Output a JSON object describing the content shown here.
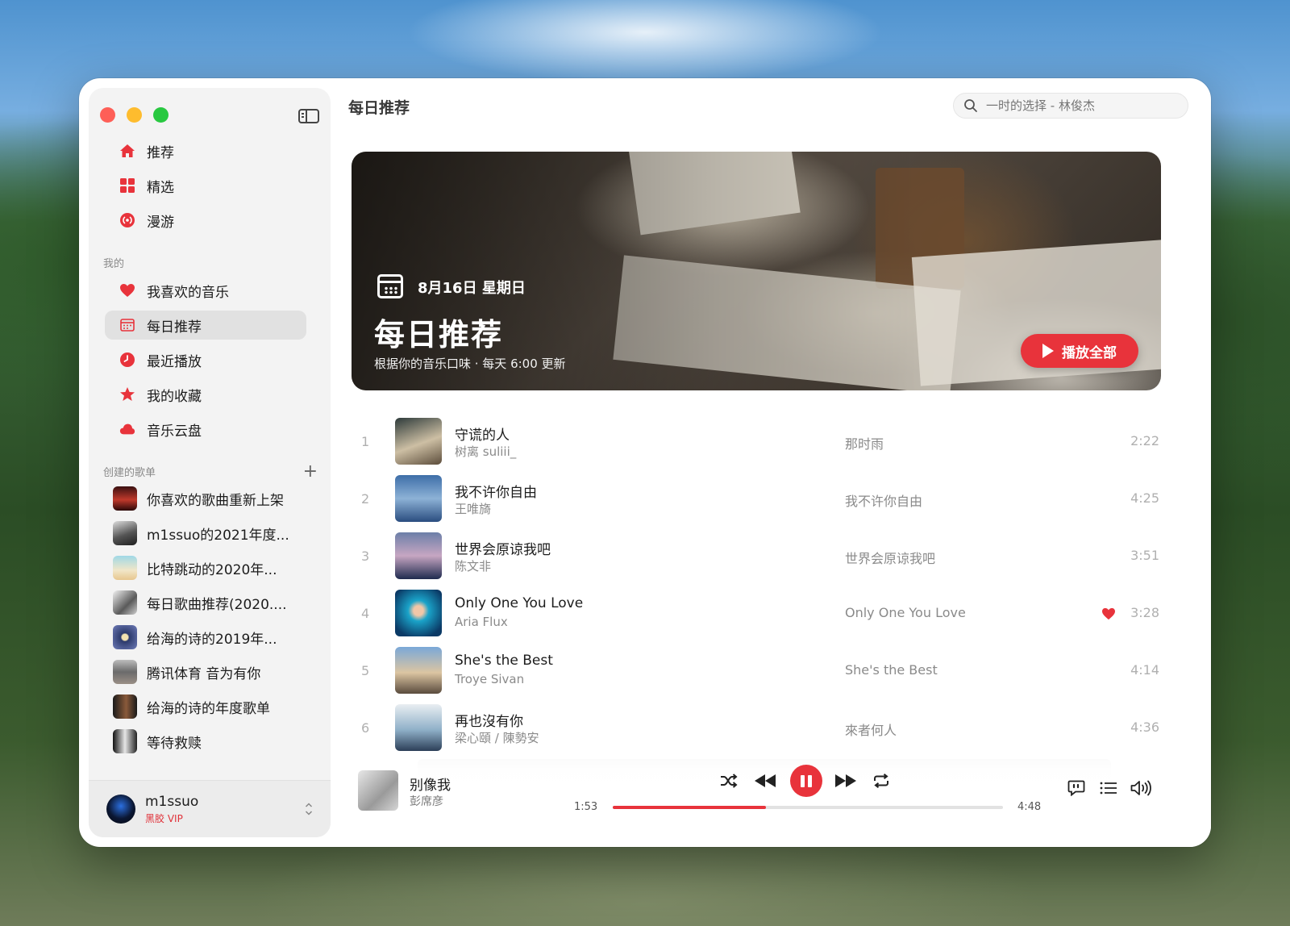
{
  "window": {
    "page_title": "每日推荐"
  },
  "search": {
    "placeholder": "一时的选择 - 林俊杰"
  },
  "sidebar": {
    "nav": [
      {
        "label": "推荐",
        "icon": "home-icon"
      },
      {
        "label": "精选",
        "icon": "grid-icon"
      },
      {
        "label": "漫游",
        "icon": "radio-icon"
      }
    ],
    "mine_label": "我的",
    "mine": [
      {
        "label": "我喜欢的音乐",
        "icon": "heart-icon"
      },
      {
        "label": "每日推荐",
        "icon": "calendar-icon",
        "active": true
      },
      {
        "label": "最近播放",
        "icon": "clock-icon"
      },
      {
        "label": "我的收藏",
        "icon": "star-icon"
      },
      {
        "label": "音乐云盘",
        "icon": "cloud-icon"
      }
    ],
    "playlists_label": "创建的歌单",
    "playlists": [
      {
        "label": "你喜欢的歌曲重新上架"
      },
      {
        "label": "m1ssuo的2021年度..."
      },
      {
        "label": "比特跳动的2020年..."
      },
      {
        "label": "每日歌曲推荐(2020...."
      },
      {
        "label": "给海的诗的2019年..."
      },
      {
        "label": "腾讯体育 音为有你"
      },
      {
        "label": "给海的诗的年度歌单"
      },
      {
        "label": "等待救赎"
      }
    ],
    "user": {
      "name": "m1ssuo",
      "badge": "黑胶 VIP"
    }
  },
  "banner": {
    "date": "8月16日 星期日",
    "title": "每日推荐",
    "subtitle": "根据你的音乐口味 · 每天 6:00 更新",
    "play_all": "播放全部"
  },
  "tracks": [
    {
      "num": "1",
      "title": "守谎的人",
      "artist": "树离 suliii_",
      "album": "那时雨",
      "duration": "2:22",
      "liked": false
    },
    {
      "num": "2",
      "title": "我不许你自由",
      "artist": "王唯旖",
      "album": "我不许你自由",
      "duration": "4:25",
      "liked": false
    },
    {
      "num": "3",
      "title": "世界会原谅我吧",
      "artist": "陈文非",
      "album": "世界会原谅我吧",
      "duration": "3:51",
      "liked": false
    },
    {
      "num": "4",
      "title": "Only One You Love",
      "artist": "Aria Flux",
      "album": "Only One You Love",
      "duration": "3:28",
      "liked": true
    },
    {
      "num": "5",
      "title": "She's the Best",
      "artist": "Troye Sivan",
      "album": "She's the Best",
      "duration": "4:14",
      "liked": false
    },
    {
      "num": "6",
      "title": "再也沒有你",
      "artist": "梁心頤 / 陳勢安",
      "album": "來者何人",
      "duration": "4:36",
      "liked": false
    }
  ],
  "player": {
    "title": "别像我",
    "artist": "彭席彦",
    "elapsed": "1:53",
    "total": "4:48",
    "progress": 0.393
  },
  "colors": {
    "accent": "#e8333b",
    "sidebar_bg": "#f3f3f3"
  }
}
